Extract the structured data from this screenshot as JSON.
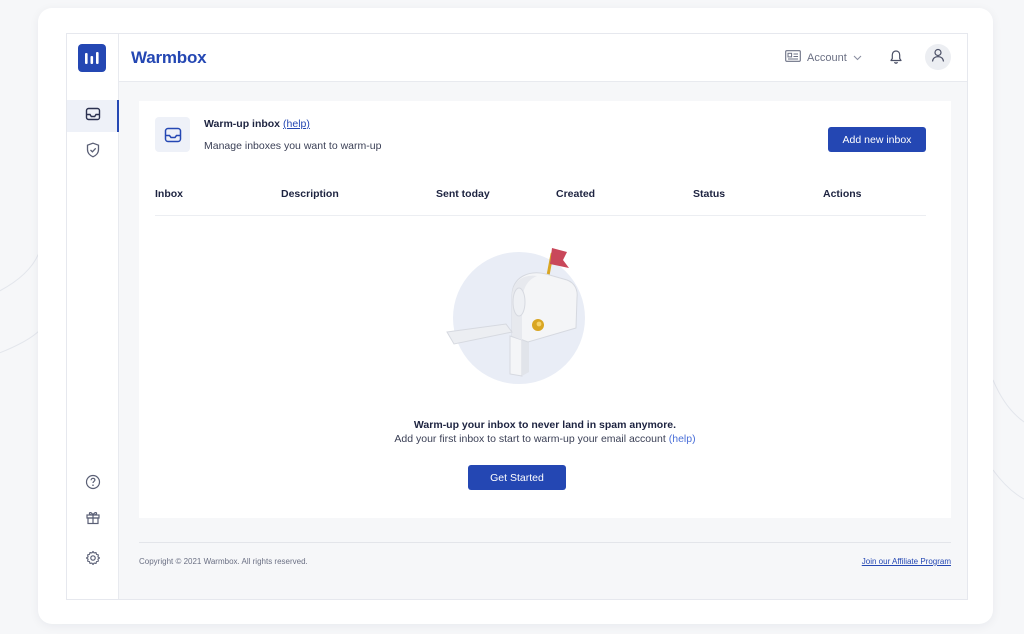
{
  "app": {
    "brand": "Warmbox"
  },
  "topbar": {
    "account_label": "Account",
    "icons": [
      "account-card-icon",
      "chevron-down-icon",
      "bell-icon",
      "user-icon"
    ]
  },
  "sidebar": {
    "top_items": [
      {
        "icon": "inbox-icon",
        "active": true
      },
      {
        "icon": "shield-check-icon",
        "active": false
      }
    ],
    "bottom_items": [
      {
        "icon": "help-circle-icon"
      },
      {
        "icon": "gift-icon"
      },
      {
        "icon": "gear-icon"
      }
    ]
  },
  "panel": {
    "title": "Warm-up inbox",
    "title_help": "(help)",
    "subtitle": "Manage inboxes you want to warm-up",
    "add_button": "Add new inbox",
    "columns": [
      "Inbox",
      "Description",
      "Sent today",
      "Created",
      "Status",
      "Actions"
    ],
    "empty": {
      "title": "Warm-up your inbox to never land in spam anymore.",
      "subtitle": "Add your first inbox to start to warm-up your email account",
      "help": "(help)",
      "button": "Get Started"
    }
  },
  "footer": {
    "copyright": "Copyright © 2021 Warmbox. All rights reserved.",
    "affiliate": "Join our Affiliate Program"
  },
  "colors": {
    "brand": "#2447b3",
    "background": "#f6f7f9",
    "flag": "#c9475a"
  }
}
